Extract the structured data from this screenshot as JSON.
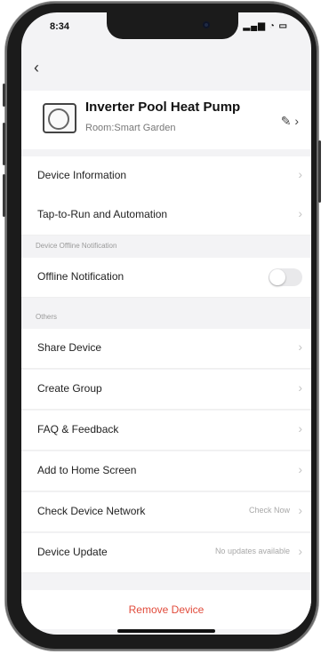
{
  "status": {
    "time": "8:34",
    "icons": "▂▄▆ ◔ ▭"
  },
  "header": {
    "back_icon": "‹",
    "title": "Inverter Pool Heat Pump",
    "room": "Room:Smart Garden",
    "edit_icon": "✎ ›"
  },
  "rows": [
    {
      "label": "Device Information"
    },
    {
      "label": "Tap-to-Run and Automation"
    }
  ],
  "offline_section": {
    "section_label": "Device Offline Notification",
    "row_label": "Offline Notification",
    "toggle_state": "off"
  },
  "others_section": {
    "section_label": "Others"
  },
  "others_rows": [
    {
      "label": "Share Device"
    },
    {
      "label": "Create Group"
    },
    {
      "label": "FAQ & Feedback"
    },
    {
      "label": "Add to Home Screen"
    },
    {
      "label": "Check Device Network",
      "value": "Check Now"
    },
    {
      "label": "Device Update",
      "value": "No updates available"
    }
  ],
  "remove_label": "Remove Device",
  "chevron": "›"
}
